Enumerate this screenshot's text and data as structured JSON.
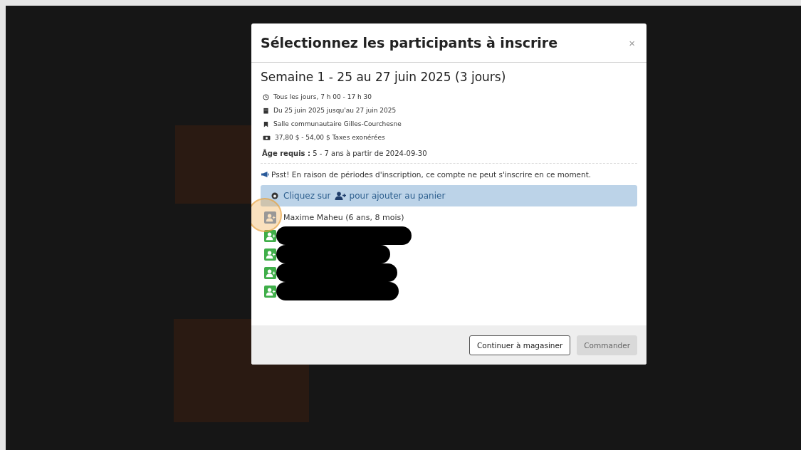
{
  "modal": {
    "title": "Sélectionnez les participants à inscrire",
    "close": "×"
  },
  "activity": {
    "title": "Semaine 1 - 25 au 27 juin 2025 (3 jours)",
    "details": [
      {
        "kind": "clock",
        "text": "Tous les jours, 7 h 00 - 17 h 30"
      },
      {
        "kind": "calendar",
        "text": "Du 25 juin 2025 jusqu'au 27 juin 2025"
      },
      {
        "kind": "place",
        "text": "Salle communautaire Gilles-Courchesne"
      },
      {
        "kind": "money",
        "text": "37,80 $ - 54,00 $ Taxes exonérées"
      }
    ],
    "age_label": "Âge requis :",
    "age_value": "5 - 7 ans à partir de 2024-09-30"
  },
  "notice": "Psst! En raison de périodes d'inscription, ce compte ne peut s'inscrire en ce moment.",
  "hint": {
    "before": "Cliquez sur",
    "after": "pour ajouter au panier"
  },
  "participants": [
    {
      "name": "Maxime Maheu (6 ans, 8 mois)",
      "selected": true,
      "redacted": false
    },
    {
      "selected": false,
      "redacted": true
    },
    {
      "selected": false,
      "redacted": true
    },
    {
      "selected": false,
      "redacted": true
    },
    {
      "selected": false,
      "redacted": true
    }
  ],
  "buttons": [
    {
      "label": "Continuer à magasiner",
      "disabled": false
    },
    {
      "label": "Commander",
      "disabled": true
    }
  ]
}
